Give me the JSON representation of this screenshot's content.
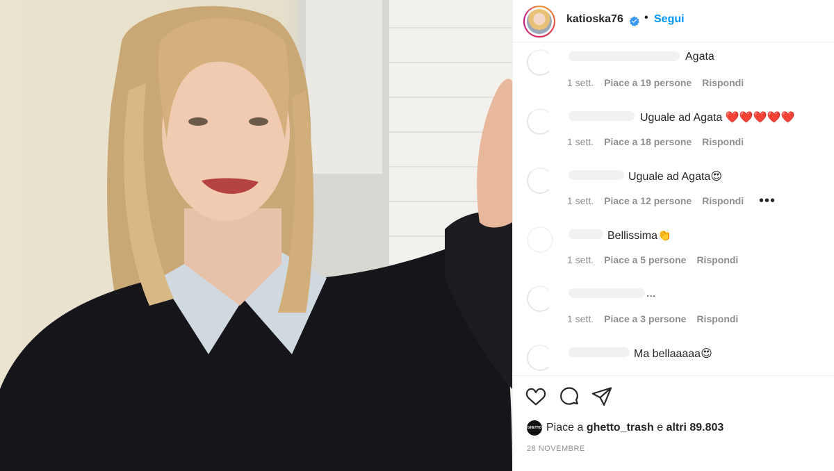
{
  "post": {
    "username": "katioska76",
    "follow_label": "Segui",
    "separator": "•",
    "verified_icon": "verified-badge-icon"
  },
  "comments": [
    {
      "text": "Agata",
      "time": "1 sett.",
      "likes": "Piace a 19 persone",
      "reply": "Rispondi"
    },
    {
      "text": "Uguale ad Agata ❤️❤️❤️❤️❤️",
      "time": "1 sett.",
      "likes": "Piace a 18 persone",
      "reply": "Rispondi"
    },
    {
      "text": "Uguale ad Agata😍",
      "time": "1 sett.",
      "likes": "Piace a 12 persone",
      "reply": "Rispondi",
      "more": "•••"
    },
    {
      "text": "Bellissima👏",
      "time": "1 sett.",
      "likes": "Piace a 5 persone",
      "reply": "Rispondi"
    },
    {
      "text": "...",
      "time": "1 sett.",
      "likes": "Piace a 3 persone",
      "reply": "Rispondi"
    },
    {
      "text": "Ma bellaaaaa😍"
    }
  ],
  "actions": {
    "like_icon": "heart-icon",
    "comment_icon": "comment-icon",
    "share_icon": "send-icon"
  },
  "likes": {
    "avatar_text": "GHETTO",
    "prefix": "Piace a",
    "user": "ghetto_trash",
    "middle": "e",
    "rest": "altri 89.803"
  },
  "date": "28 NOVEMBRE",
  "colors": {
    "accent": "#0095f6",
    "text": "#262626",
    "muted": "#8e8e8e",
    "border": "#efefef"
  }
}
